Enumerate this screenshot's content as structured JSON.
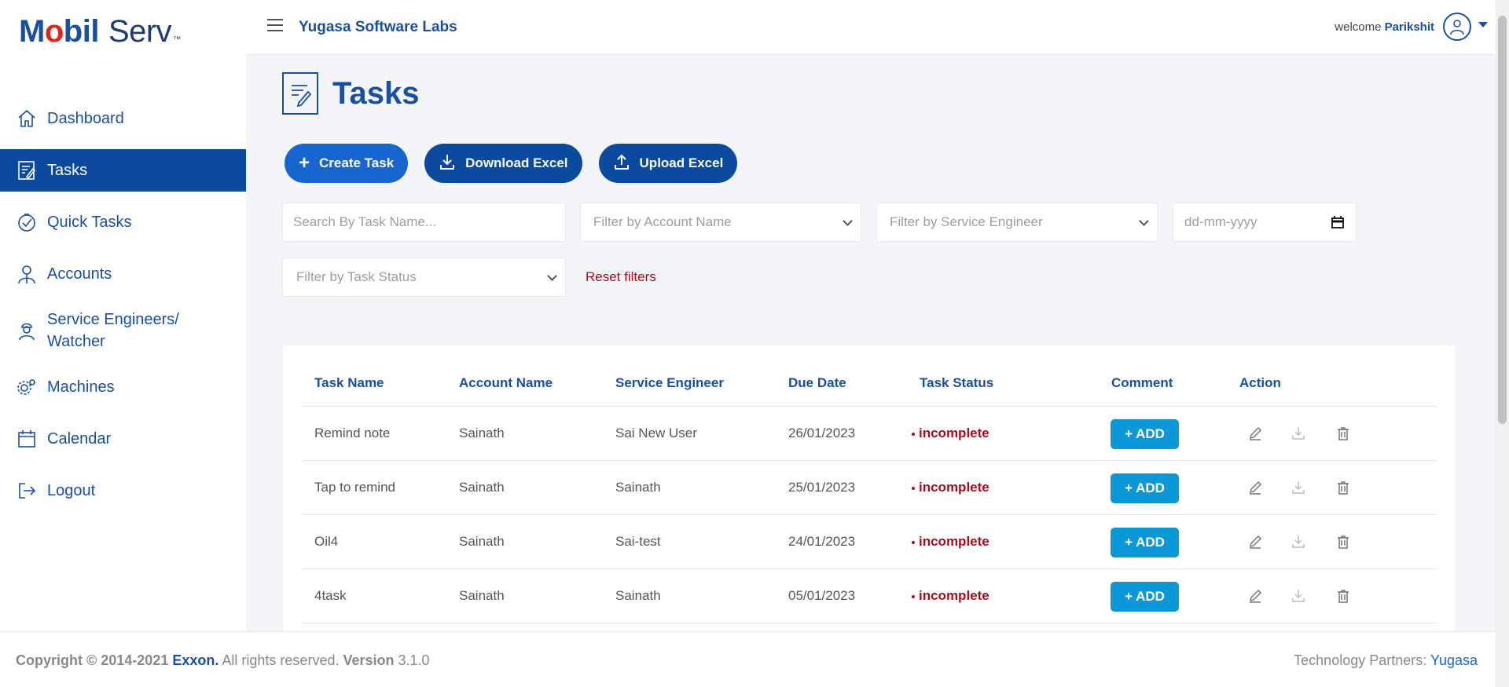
{
  "logo": {
    "part1_a": "M",
    "part1_o": "o",
    "part1_b": "bil",
    "part2": "Serv",
    "tm": "™"
  },
  "header": {
    "company": "Yugasa Software Labs",
    "welcome_prefix": "welcome",
    "username": "Parikshit"
  },
  "sidebar": {
    "items": [
      {
        "label": "Dashboard",
        "icon": "home-icon"
      },
      {
        "label": "Tasks",
        "icon": "tasks-icon",
        "active": true
      },
      {
        "label": "Quick Tasks",
        "icon": "quick-tasks-icon"
      },
      {
        "label": "Accounts",
        "icon": "accounts-icon"
      },
      {
        "label_line1": "Service Engineers/",
        "label_line2": "Watcher",
        "icon": "engineer-icon"
      },
      {
        "label": "Machines",
        "icon": "machines-icon"
      },
      {
        "label": "Calendar",
        "icon": "calendar-icon"
      },
      {
        "label": "Logout",
        "icon": "logout-icon"
      }
    ]
  },
  "page": {
    "title": "Tasks"
  },
  "buttons": {
    "create": "Create Task",
    "download": "Download Excel",
    "upload": "Upload Excel"
  },
  "filters": {
    "search_placeholder": "Search By Task Name...",
    "account": "Filter by Account Name",
    "engineer": "Filter by Service Engineer",
    "date_placeholder": "dd-mm-yyyy",
    "status": "Filter by Task Status",
    "reset": "Reset filters"
  },
  "table": {
    "headers": [
      "Task Name",
      "Account Name",
      "Service Engineer",
      "Due Date",
      "Task Status",
      "Comment",
      "Action"
    ],
    "add_label": "+ ADD",
    "rows": [
      {
        "task": "Remind note",
        "account": "Sainath",
        "engineer": "Sai New User",
        "due": "26/01/2023",
        "status": "incomplete"
      },
      {
        "task": "Tap to remind",
        "account": "Sainath",
        "engineer": "Sainath",
        "due": "25/01/2023",
        "status": "incomplete"
      },
      {
        "task": "Oil4",
        "account": "Sainath",
        "engineer": "Sai-test",
        "due": "24/01/2023",
        "status": "incomplete"
      },
      {
        "task": "4task",
        "account": "Sainath",
        "engineer": "Sainath",
        "due": "05/01/2023",
        "status": "incomplete"
      }
    ]
  },
  "footer": {
    "copyright": "Copyright © 2014-2021",
    "brand": "Exxon.",
    "rights": "All rights reserved.",
    "version_label": "Version",
    "version": "3.1.0",
    "partners": "Technology Partners:",
    "partner_name": "Yugasa"
  },
  "colors": {
    "primary": "#1766d0",
    "dark": "#0b4a9f",
    "status_incomplete": "#a50d1e",
    "add_button": "#0c98d7"
  }
}
